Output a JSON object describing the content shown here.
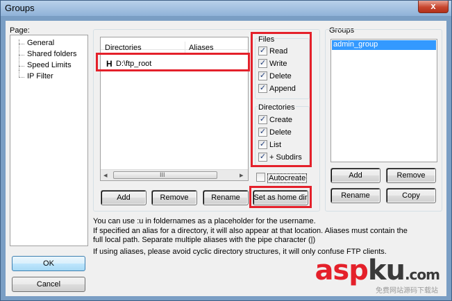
{
  "window": {
    "title": "Groups",
    "close_glyph": "x"
  },
  "page": {
    "label": "Page:",
    "items": [
      "General",
      "Shared folders",
      "Speed Limits",
      "IP Filter"
    ]
  },
  "dirs": {
    "col_directories": "Directories",
    "col_aliases": "Aliases",
    "rows": [
      {
        "flag": "H",
        "path": "D:\\ftp_root"
      }
    ],
    "scroll_left": "◂",
    "scroll_right": "▸",
    "scroll_grip": "III",
    "add": "Add",
    "remove": "Remove",
    "rename": "Rename",
    "set_home": "Set as home dir"
  },
  "files": {
    "legend": "Files",
    "items": [
      {
        "label": "Read",
        "checked": true
      },
      {
        "label": "Write",
        "checked": true
      },
      {
        "label": "Delete",
        "checked": true
      },
      {
        "label": "Append",
        "checked": true
      }
    ]
  },
  "directories": {
    "legend": "Directories",
    "items": [
      {
        "label": "Create",
        "checked": true
      },
      {
        "label": "Delete",
        "checked": true
      },
      {
        "label": "List",
        "checked": true
      },
      {
        "label": "+ Subdirs",
        "checked": true
      }
    ]
  },
  "autocreate": {
    "label": "Autocreate",
    "checked": false
  },
  "groups": {
    "legend": "Groups",
    "items": [
      "admin_group"
    ],
    "add": "Add",
    "remove": "Remove",
    "rename": "Rename",
    "copy": "Copy"
  },
  "info": {
    "line1": "You can use :u in foldernames as a placeholder for the username.",
    "line2": "If specified an alias for a directory, it will also appear at that location. Aliases must contain the",
    "line3": "full local path. Separate multiple aliases with the pipe character (|)",
    "line4": "If using aliases, please avoid cyclic directory structures, it will only confuse FTP clients."
  },
  "buttons": {
    "ok": "OK",
    "cancel": "Cancel"
  },
  "watermark": {
    "text_a": "asp",
    "text_b": "ku",
    "text_c": ".com",
    "sub": "免费网站源码下载站"
  },
  "colors": {
    "highlight": "#3399ff",
    "accent_red": "#e4202a"
  }
}
